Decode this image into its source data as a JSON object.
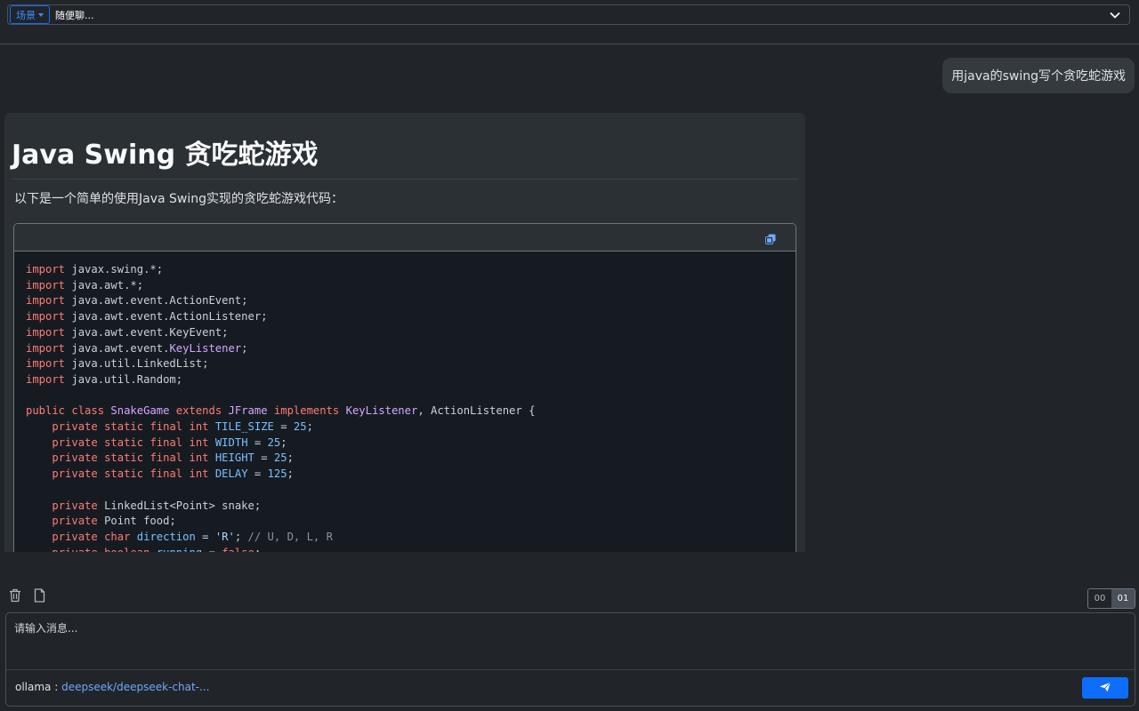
{
  "topbar": {
    "scene_label": "场景",
    "scene_value": "随便聊..."
  },
  "chat": {
    "user_message": "用java的swing写个贪吃蛇游戏",
    "assistant": {
      "heading": "Java Swing 贪吃蛇游戏",
      "intro": "以下是一个简单的使用Java Swing实现的贪吃蛇游戏代码："
    }
  },
  "code_lines": [
    "import javax.swing.*;",
    "import java.awt.*;",
    "import java.awt.event.ActionEvent;",
    "import java.awt.event.ActionListener;",
    "import java.awt.event.KeyEvent;",
    "import java.awt.event.KeyListener;",
    "import java.util.LinkedList;",
    "import java.util.Random;",
    "",
    "public class SnakeGame extends JFrame implements KeyListener, ActionListener {",
    "    private static final int TILE_SIZE = 25;",
    "    private static final int WIDTH = 25;",
    "    private static final int HEIGHT = 25;",
    "    private static final int DELAY = 125;",
    "",
    "    private LinkedList<Point> snake;",
    "    private Point food;",
    "    private char direction = 'R'; // U, D, L, R",
    "    private boolean running = false;"
  ],
  "composer": {
    "placeholder": "请输入消息...",
    "provider": "ollama :",
    "model": "deepseek/deepseek-chat-..."
  },
  "toggle": {
    "left": "00",
    "right": "01"
  },
  "icons": {
    "scene_caret": "caret-down-icon",
    "dropdown": "chevron-down-icon",
    "copy": "copy-icon",
    "trash": "trash-icon",
    "file": "file-icon",
    "send": "send-icon"
  },
  "colors": {
    "background": "#212529",
    "accent": "#0d6efd",
    "keyword": "#ff7b72",
    "type": "#d2a8ff",
    "constant": "#79c0ff"
  }
}
